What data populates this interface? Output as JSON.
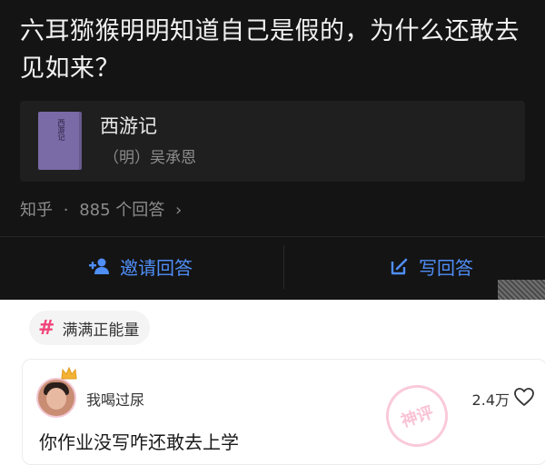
{
  "question": {
    "title": "六耳猕猴明明知道自己是假的，为什么还敢去见如来？"
  },
  "book": {
    "cover_text": "西游记",
    "title": "西游记",
    "author": "（明）吴承恩"
  },
  "meta": {
    "source": "知乎",
    "separator": "·",
    "answer_count": "885 个回答",
    "chevron": "›"
  },
  "actions": {
    "invite_label": "邀请回答",
    "write_label": "写回答",
    "accent_color": "#4f8ef7"
  },
  "topic": {
    "hash": "#",
    "label": "满满正能量",
    "accent_color": "#f0457a"
  },
  "comment": {
    "username": "我喝过尿",
    "likes": "2.4万",
    "text": "你作业没写咋还敢去上学",
    "stamp": "神评"
  },
  "icons": {
    "invite": "add-person-icon",
    "write": "edit-icon",
    "like": "heart-icon",
    "crown": "crown-icon"
  }
}
